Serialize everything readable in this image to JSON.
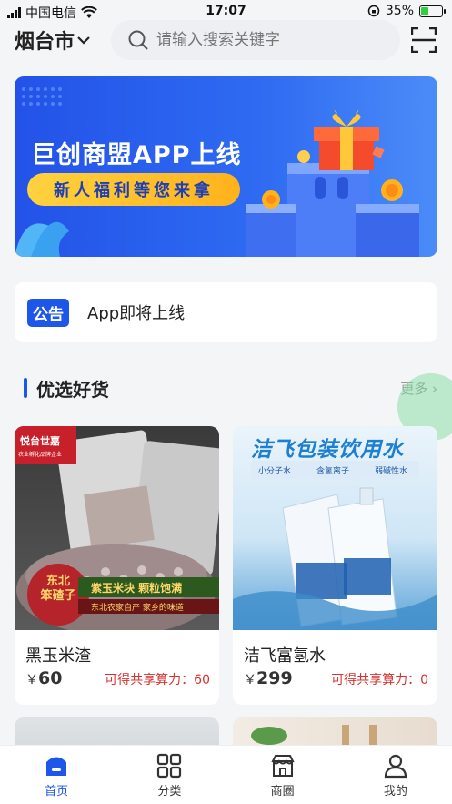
{
  "status": {
    "carrier": "中国电信",
    "time": "17:07",
    "battery": "35%"
  },
  "header": {
    "city": "烟台市",
    "search_placeholder": "请输入搜索关键字"
  },
  "banner": {
    "title": "巨创商盟APP上线",
    "subtitle": "新人福利等您来拿"
  },
  "notice": {
    "tag": "公告",
    "text": "App即将上线"
  },
  "section": {
    "title": "优选好货",
    "more": "更多"
  },
  "products": [
    {
      "name": "黑玉米渣",
      "currency": "￥",
      "price": "60",
      "share_label": "可得共享算力：",
      "share_value": "60",
      "img": {
        "brand": "悦台世嘉",
        "brand_sub": "农业孵化品牌企业",
        "badge": "东北\n笨碴子",
        "slogan1": "紫玉米块 颗粒饱满",
        "slogan2": "东北农家自产 家乡的味道"
      }
    },
    {
      "name": "洁飞富氢水",
      "currency": "￥",
      "price": "299",
      "share_label": "可得共享算力：",
      "share_value": "0",
      "img": {
        "headline": "洁飞包装饮用水",
        "tags": [
          "小分子水",
          "含氢离子",
          "弱碱性水"
        ]
      }
    }
  ],
  "tabs": [
    {
      "label": "首页",
      "icon": "home-icon",
      "active": true
    },
    {
      "label": "分类",
      "icon": "grid-icon",
      "active": false
    },
    {
      "label": "商圈",
      "icon": "store-icon",
      "active": false
    },
    {
      "label": "我的",
      "icon": "user-icon",
      "active": false
    }
  ],
  "colors": {
    "accent": "#1d56e8",
    "price_red": "#d6322f"
  }
}
